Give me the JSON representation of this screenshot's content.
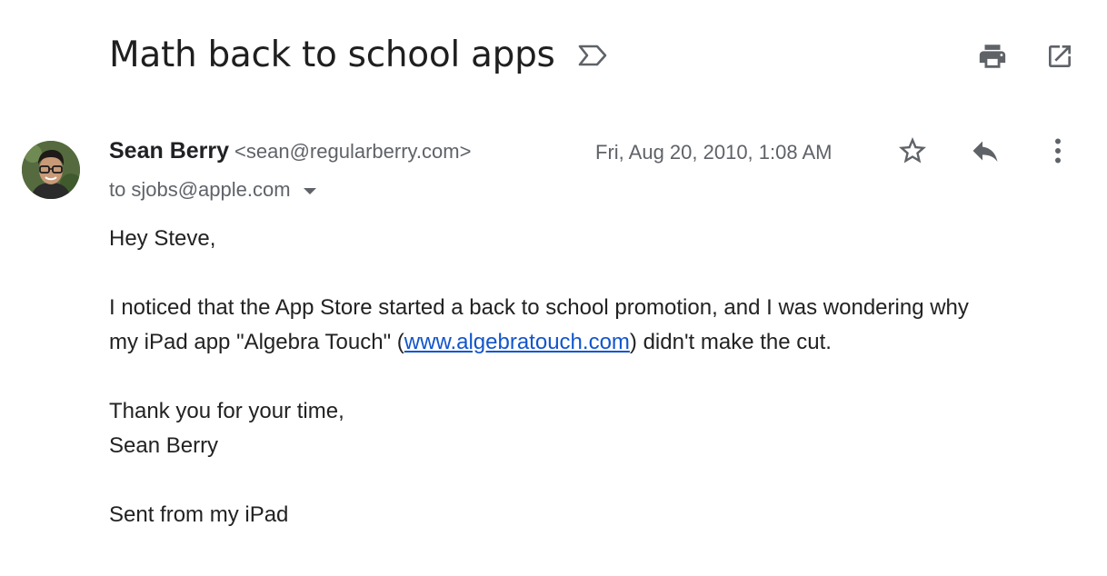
{
  "subject": "Math back to school apps",
  "icons": {
    "label": "label-important-icon",
    "print": "print-icon",
    "open_new_window": "open-in-new-icon",
    "star": "star-icon",
    "reply": "reply-icon",
    "more": "more-vert-icon"
  },
  "message": {
    "sender_name": "Sean Berry",
    "sender_email": "<sean@regularberry.com>",
    "date": "Fri, Aug 20, 2010, 1:08 AM",
    "to_prefix": "to",
    "to_address": "sjobs@apple.com",
    "body": {
      "greeting": "Hey Steve,",
      "para1_line1": "I noticed that the App Store started a back to school promotion, and I was wondering why",
      "para1_line2_pre": "my iPad app \"Algebra Touch\" (",
      "link_text": "www.algebratouch.com",
      "para1_line2_post": ") didn't make the cut.",
      "signoff": "Thank you for your time,",
      "signature": "Sean Berry",
      "footer": "Sent from my iPad"
    }
  },
  "colors": {
    "text": "#202124",
    "muted": "#5f6368",
    "link": "#1155cc",
    "icon": "#5f6368"
  }
}
